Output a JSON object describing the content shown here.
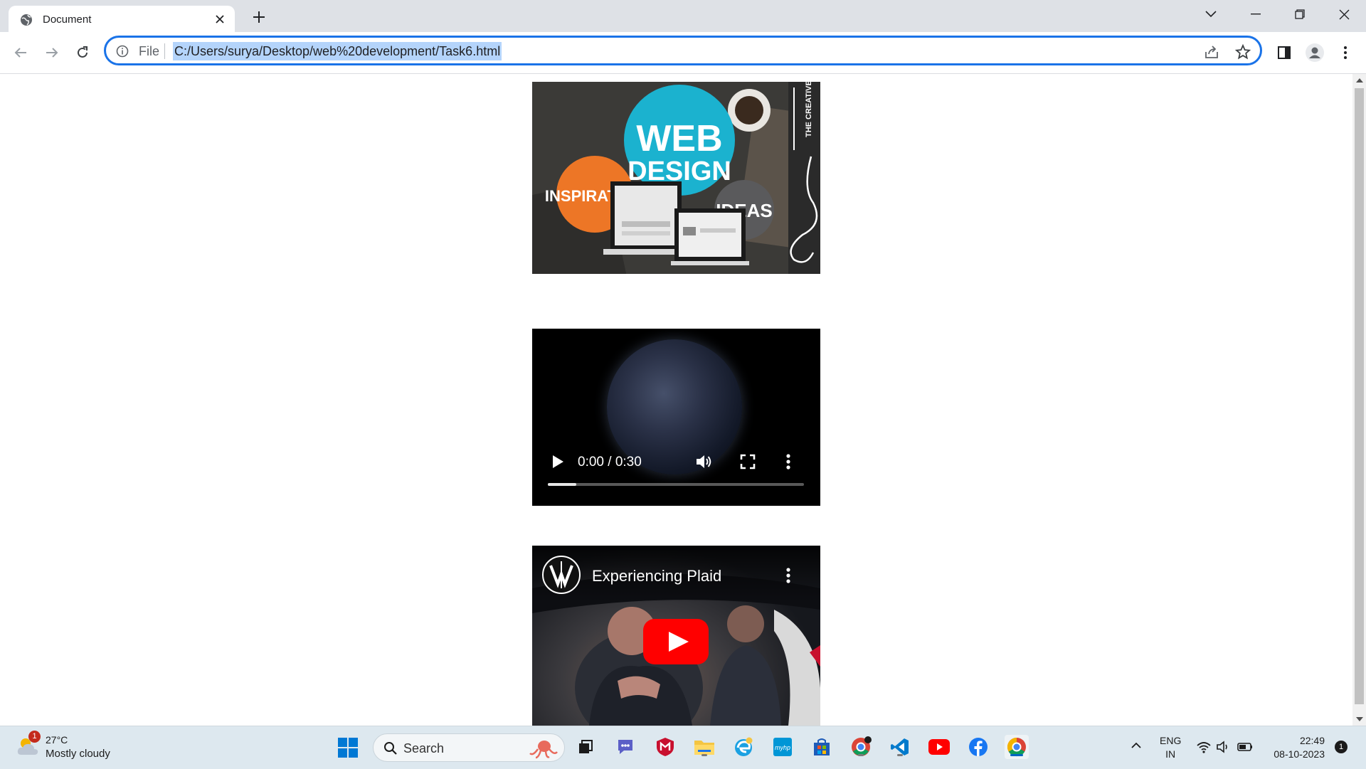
{
  "browser": {
    "tab_title": "Document",
    "omnibox": {
      "scheme": "File",
      "url": "C:/Users/surya/Desktop/web%20development/Task6.html"
    }
  },
  "page": {
    "image": {
      "heading_main": "WEB",
      "heading_sub": "DESIGN",
      "left_circle": "INSPIRATION",
      "right_circle": "IDEAS",
      "brand": "THE CREATIVE MOMENTUM"
    },
    "video": {
      "time": "0:00 / 0:30",
      "progress": 0.11
    },
    "youtube": {
      "title": "Experiencing Plaid"
    }
  },
  "taskbar": {
    "weather": {
      "temp": "27°C",
      "desc": "Mostly cloudy",
      "badge": "1"
    },
    "search_label": "Search",
    "lang_top": "ENG",
    "lang_bottom": "IN",
    "time": "22:49",
    "date": "08-10-2023",
    "notifications": "1"
  },
  "colors": {
    "accent": "#1a73e8",
    "url_highlight": "#b4d4fb",
    "youtube_red": "#ff0000"
  }
}
